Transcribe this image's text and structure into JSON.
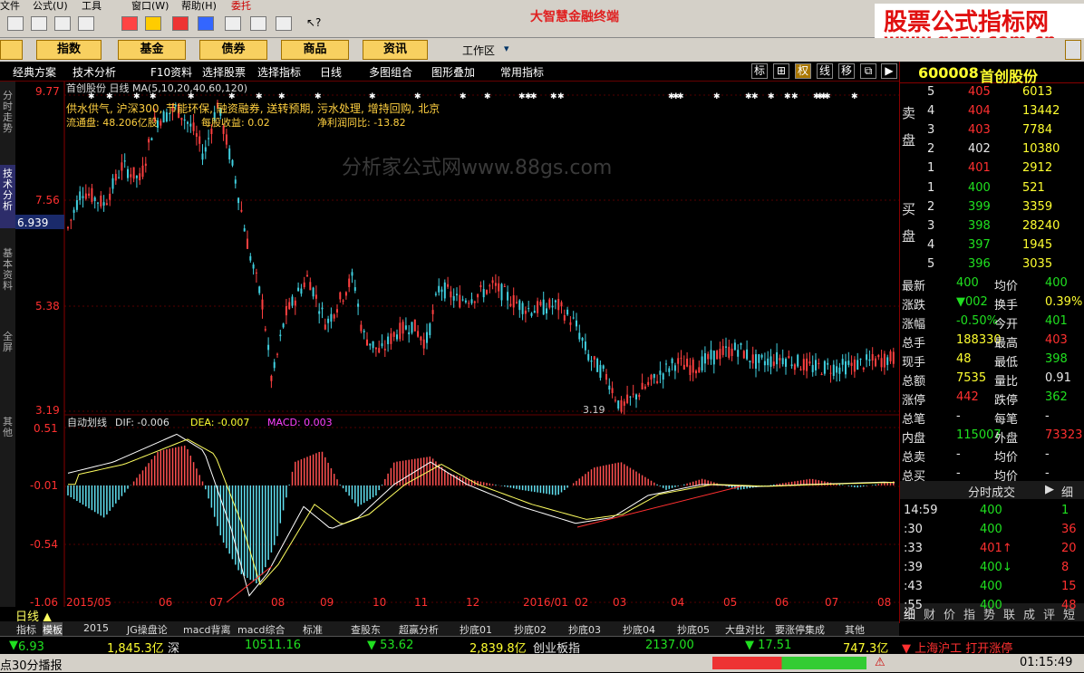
{
  "menubar": {
    "items": [
      "文件",
      "公式(U)",
      "工具",
      "窗口(W)",
      "帮助(H)"
    ],
    "entrust": "委托",
    "app_title": "大智慧金融终端"
  },
  "watermark": {
    "line1": "股票公式指标网",
    "line2": "www.gszx.com.cn"
  },
  "nav": {
    "buttons": [
      "指数",
      "基金",
      "债券",
      "商品",
      "资讯"
    ],
    "workzone": "工作区"
  },
  "subbar": {
    "items": [
      "经典方案",
      "技术分析",
      "F10资料",
      "选择股票",
      "选择指标",
      "日线",
      "多图组合",
      "图形叠加",
      "常用指标"
    ],
    "right_buttons": [
      "标",
      "⊞",
      "权",
      "线",
      "移",
      "⧉",
      "▶"
    ]
  },
  "leftbar": {
    "tabs": [
      "分时走势",
      "技术分析",
      "基本资料",
      "全屏",
      "其他"
    ]
  },
  "chart": {
    "stock_line": "首创股份 日线 MA(5,10,20,40,60,120)",
    "concepts": "供水供气, 沪深300, 节能环保, 融资融券, 送转预期, 污水处理, 增持回购, 北京",
    "float_label": "流通盘: 48.206亿股",
    "eps_label": "每股收益: 0.02",
    "profit_label": "净利润同比: -13.82",
    "price_axis": [
      "9.77",
      "7.56",
      "5.38",
      "3.19"
    ],
    "current_price": "6.939",
    "low_annot": "3.19",
    "center_wm": "分析家公式网www.88gs.com",
    "macd_title": "自动划线",
    "dif_label": "DIF: -0.006",
    "dea_label": "DEA: -0.007",
    "macd_label": "MACD: 0.003",
    "macd_axis": [
      "0.51",
      "-0.01",
      "-0.54",
      "-1.06"
    ],
    "date_axis": [
      "2015/05",
      "06",
      "07",
      "08",
      "09",
      "10",
      "11",
      "12",
      "2016/01",
      "02",
      "03",
      "04",
      "05",
      "06",
      "07",
      "08"
    ],
    "period_label": "日线"
  },
  "right": {
    "code": "600008",
    "name": "首创股份",
    "sell_label": "卖 盘",
    "buy_label": "买 盘",
    "asks": [
      {
        "n": "5",
        "p": "405",
        "v": "6013"
      },
      {
        "n": "4",
        "p": "404",
        "v": "13442"
      },
      {
        "n": "3",
        "p": "403",
        "v": "7784"
      },
      {
        "n": "2",
        "p": "402",
        "v": "10380"
      },
      {
        "n": "1",
        "p": "401",
        "v": "2912"
      }
    ],
    "bids": [
      {
        "n": "1",
        "p": "400",
        "v": "521"
      },
      {
        "n": "2",
        "p": "399",
        "v": "3359"
      },
      {
        "n": "3",
        "p": "398",
        "v": "28240"
      },
      {
        "n": "4",
        "p": "397",
        "v": "1945"
      },
      {
        "n": "5",
        "p": "396",
        "v": "3035"
      }
    ],
    "stats": [
      {
        "l1": "最新",
        "v1": "400",
        "c1": "green",
        "l2": "均价",
        "v2": "400",
        "c2": "green"
      },
      {
        "l1": "涨跌",
        "v1": "▼002",
        "c1": "green",
        "l2": "换手",
        "v2": "0.39%",
        "c2": "yellow"
      },
      {
        "l1": "涨幅",
        "v1": "-0.50%",
        "c1": "green",
        "l2": "今开",
        "v2": "401",
        "c2": "green"
      },
      {
        "l1": "总手",
        "v1": "188330",
        "c1": "yellow",
        "l2": "最高",
        "v2": "403",
        "c2": "red"
      },
      {
        "l1": "现手",
        "v1": "48",
        "c1": "yellow",
        "l2": "最低",
        "v2": "398",
        "c2": "green"
      },
      {
        "l1": "总额",
        "v1": "7535",
        "c1": "yellow",
        "l2": "量比",
        "v2": "0.91",
        "c2": "white"
      },
      {
        "l1": "涨停",
        "v1": "442",
        "c1": "red",
        "l2": "跌停",
        "v2": "362",
        "c2": "green"
      },
      {
        "l1": "总笔",
        "v1": "-",
        "c1": "white",
        "l2": "每笔",
        "v2": "-",
        "c2": "white"
      },
      {
        "l1": "内盘",
        "v1": "115007",
        "c1": "green",
        "l2": "外盘",
        "v2": "73323",
        "c2": "red"
      },
      {
        "l1": "总卖",
        "v1": "-",
        "c1": "white",
        "l2": "均价",
        "v2": "-",
        "c2": "white"
      },
      {
        "l1": "总买",
        "v1": "-",
        "c1": "white",
        "l2": "均价",
        "v2": "-",
        "c2": "white"
      }
    ],
    "ticks_header": "分时成交",
    "ticks_detail": "细",
    "ticks": [
      {
        "t": "14:59",
        "p": "400",
        "v": "1"
      },
      {
        "t": ":30",
        "p": "400",
        "v": "36"
      },
      {
        "t": ":33",
        "p": "401↑",
        "v": "20"
      },
      {
        "t": ":39",
        "p": "400↓",
        "v": "8"
      },
      {
        "t": ":43",
        "p": "400",
        "v": "15"
      },
      {
        "t": ":55",
        "p": "400",
        "v": "48"
      }
    ],
    "bottom_tabs": [
      "细",
      "财",
      "价",
      "指",
      "势",
      "联",
      "成",
      "评",
      "短"
    ]
  },
  "bottom_tabs": [
    "指标",
    "模板",
    "2015",
    "JG操盘论",
    "macd背离",
    "macd综合",
    "标准",
    "查股东",
    "超赢分析",
    "抄底01",
    "抄底02",
    "抄底03",
    "抄底04",
    "抄底05",
    "大盘对比",
    "要涨停集成",
    "其他"
  ],
  "ticker": {
    "v1": "6.93",
    "v2": "1,845.3亿",
    "v3": "深",
    "v4": "10511.16",
    "v5": "▼ 53.62",
    "v6": "2,839.8亿",
    "v7": "创业板指",
    "v8": "2137.00",
    "v9": "▼ 17.51",
    "v10": "747.3亿",
    "v11": "▼ 上海沪工 打开涨停"
  },
  "status": {
    "left": "点30分播报",
    "time": "01:15:49"
  },
  "colors": {
    "up": "#ff3030",
    "down": "#30e0e0",
    "accent": "#f8d060"
  }
}
